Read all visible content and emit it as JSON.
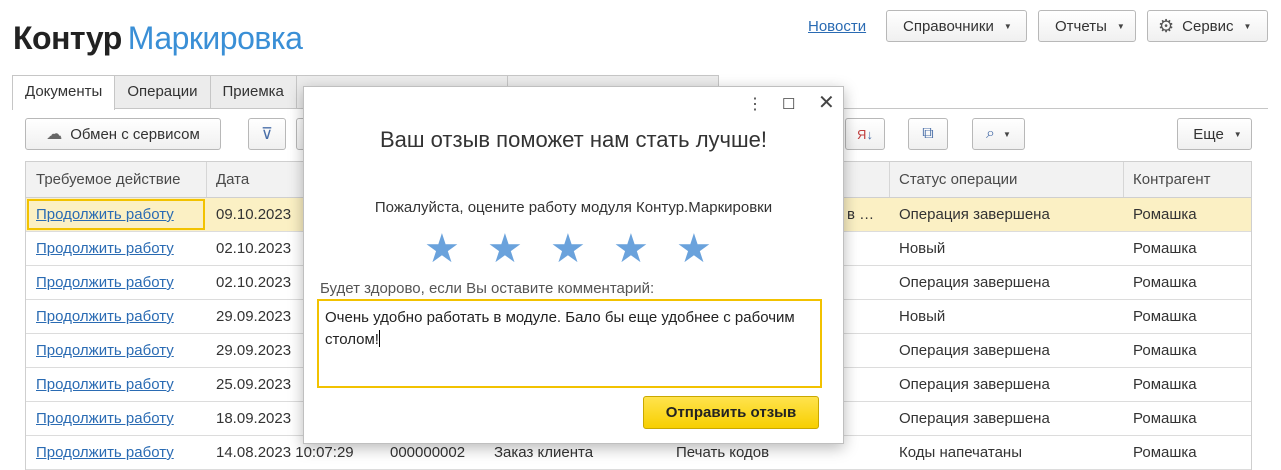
{
  "header": {
    "logo_brand": "Контур",
    "logo_product": "Маркировка",
    "news": "Новости",
    "menus": [
      "Справочники",
      "Отчеты",
      "Сервис"
    ]
  },
  "tabs": [
    "Документы",
    "Операции",
    "Приемка"
  ],
  "toolbar": {
    "exchange": "Обмен с сервисом",
    "more": "Еще"
  },
  "table": {
    "columns": [
      "Требуемое действие",
      "Дата",
      "",
      "",
      "",
      "Статус операции",
      "Контрагент"
    ],
    "rows": [
      {
        "action": "Продолжить работу",
        "date": "09.10.2023",
        "number": "",
        "doc": "",
        "op": "в …",
        "status": "Операция завершена",
        "counterparty": "Ромашка"
      },
      {
        "action": "Продолжить работу",
        "date": "02.10.2023",
        "number": "",
        "doc": "",
        "op": "",
        "status": "Новый",
        "counterparty": "Ромашка"
      },
      {
        "action": "Продолжить работу",
        "date": "02.10.2023",
        "number": "",
        "doc": "",
        "op": "",
        "status": "Операция завершена",
        "counterparty": "Ромашка"
      },
      {
        "action": "Продолжить работу",
        "date": "29.09.2023",
        "number": "",
        "doc": "",
        "op": "",
        "status": "Новый",
        "counterparty": "Ромашка"
      },
      {
        "action": "Продолжить работу",
        "date": "29.09.2023",
        "number": "",
        "doc": "",
        "op": "",
        "status": "Операция завершена",
        "counterparty": "Ромашка"
      },
      {
        "action": "Продолжить работу",
        "date": "25.09.2023",
        "number": "",
        "doc": "",
        "op": "",
        "status": "Операция завершена",
        "counterparty": "Ромашка"
      },
      {
        "action": "Продолжить работу",
        "date": "18.09.2023",
        "number": "",
        "doc": "",
        "op": "",
        "status": "Операция завершена",
        "counterparty": "Ромашка"
      },
      {
        "action": "Продолжить работу",
        "date": "14.08.2023 10:07:29",
        "number": "000000002",
        "doc": "Заказ клиента",
        "op": "Печать кодов",
        "status": "Коды напечатаны",
        "counterparty": "Ромашка"
      }
    ]
  },
  "dialog": {
    "title": "Ваш отзыв поможет нам стать лучше!",
    "prompt": "Пожалуйста, оцените работу модуля Контур.Маркировки",
    "rating_max": 5,
    "comment_label": "Будет здорово, если Вы оставите комментарий:",
    "comment_text": "Очень удобно работать в модуле. Бало бы еще удобнее с рабочим столом!",
    "submit": "Отправить отзыв"
  },
  "colors": {
    "accent_blue": "#3a8fd6",
    "link": "#2a6bb3",
    "selected_row": "#fbf0c4",
    "focus_yellow": "#f2c200",
    "submit_button": "#f7cf00",
    "star": "#6aa2dc"
  }
}
